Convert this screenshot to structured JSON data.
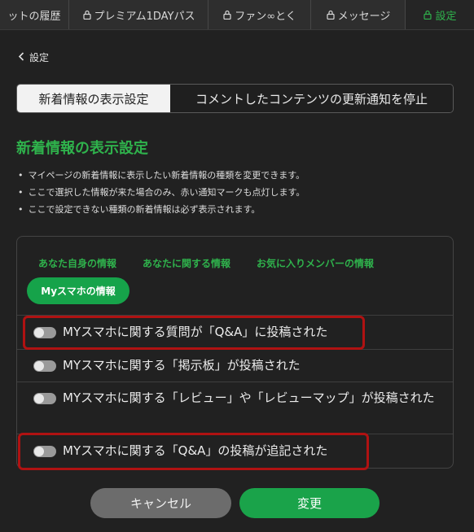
{
  "tabs": [
    {
      "label": "ットの履歴",
      "locked": false
    },
    {
      "label": "プレミアム1DAYパス",
      "locked": true
    },
    {
      "label": "ファン∞とく",
      "locked": true
    },
    {
      "label": "メッセージ",
      "locked": true
    },
    {
      "label": "設定",
      "locked": true,
      "active": true
    }
  ],
  "back_label": "設定",
  "segments": [
    "新着情報の表示設定",
    "コメントしたコンテンツの更新通知を停止"
  ],
  "heading": "新着情報の表示設定",
  "notes": [
    "マイページの新着情報に表示したい新着情報の種類を変更できます。",
    "ここで選択した情報が来た場合のみ、赤い通知マークも点灯します。",
    "ここで設定できない種類の新着情報は必ず表示されます。"
  ],
  "categories": [
    "あなた自身の情報",
    "あなたに関する情報",
    "お気に入りメンバーの情報"
  ],
  "active_category": "Myスマホの情報",
  "settings": [
    {
      "label": "MYスマホに関する質問が「Q&A」に投稿された",
      "on": false,
      "highlighted": true
    },
    {
      "label": "MYスマホに関する「掲示板」が投稿された",
      "on": false,
      "highlighted": false
    },
    {
      "label": "MYスマホに関する「レビュー」や「レビューマップ」が投稿された",
      "on": false,
      "highlighted": false
    },
    {
      "label": "MYスマホに関する「Q&A」の投稿が追記された",
      "on": false,
      "highlighted": true
    }
  ],
  "buttons": {
    "cancel": "キャンセル",
    "submit": "変更"
  },
  "colors": {
    "accent": "#2fb24c",
    "highlight": "#b01212",
    "background": "#212121"
  }
}
